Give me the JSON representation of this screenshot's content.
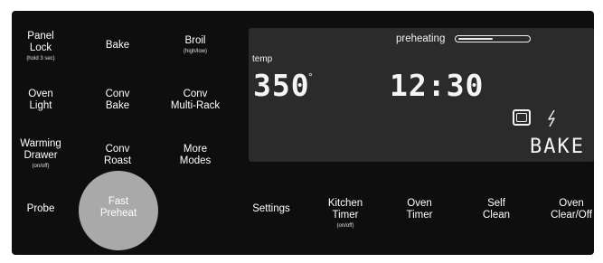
{
  "left_buttons": [
    {
      "label": "Panel\nLock",
      "sub": "(hold 3 sec)"
    },
    {
      "label": "Bake",
      "sub": ""
    },
    {
      "label": "Broil",
      "sub": "(high/low)"
    },
    {
      "label": "Oven\nLight",
      "sub": ""
    },
    {
      "label": "Conv\nBake",
      "sub": ""
    },
    {
      "label": "Conv\nMulti-Rack",
      "sub": ""
    },
    {
      "label": "Warming\nDrawer",
      "sub": "(on/off)"
    },
    {
      "label": "Conv\nRoast",
      "sub": ""
    },
    {
      "label": "More\nModes",
      "sub": ""
    },
    {
      "label": "Probe",
      "sub": ""
    },
    {
      "label": "Fast\nPreheat",
      "sub": ""
    }
  ],
  "bottom_buttons": [
    {
      "label": "Settings",
      "sub": ""
    },
    {
      "label": "Kitchen\nTimer",
      "sub": "(on/off)"
    },
    {
      "label": "Oven\nTimer",
      "sub": ""
    },
    {
      "label": "Self\nClean",
      "sub": ""
    },
    {
      "label": "Oven\nClear/Off",
      "sub": ""
    }
  ],
  "display": {
    "status": "preheating",
    "preheat_progress": 0.5,
    "temp_label": "temp",
    "temperature": "350",
    "degree": "°",
    "clock": "12:30",
    "mode": "BAKE",
    "icons": [
      "oven-cavity-icon",
      "lightning-bolt-icon"
    ]
  },
  "colors": {
    "panel": "#0e0e0e",
    "display": "#2b2b2b",
    "fast_preheat_highlight": "#a9a9a9",
    "text": "#ffffff"
  }
}
